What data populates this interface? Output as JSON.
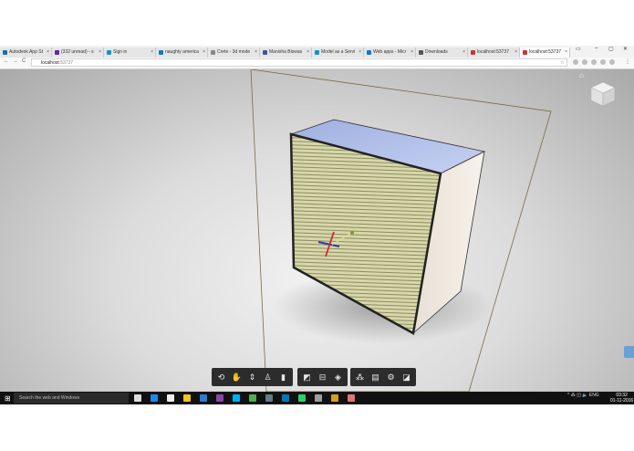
{
  "browser": {
    "tabs": [
      {
        "label": "Autodesk App St",
        "color": "#0b72b5"
      },
      {
        "label": "(332 unread) - s",
        "color": "#6b21a8"
      },
      {
        "label": "Sign in",
        "color": "#0696d7"
      },
      {
        "label": "naughty america",
        "color": "#0a7cc1"
      },
      {
        "label": "Crete - 3d mode",
        "color": "#888888"
      },
      {
        "label": "Manisha Biswas",
        "color": "#3b5998"
      },
      {
        "label": "Model as a Servi",
        "color": "#0696d7"
      },
      {
        "label": "Web apps - Micr",
        "color": "#0078d7"
      },
      {
        "label": "Downloads",
        "color": "#555555"
      },
      {
        "label": "localhost:53737",
        "color": "#cc3333"
      },
      {
        "label": "localhost:53737",
        "color": "#cc3333"
      }
    ],
    "window_controls": {
      "minimize": "–",
      "maximize": "▢",
      "close": "✕"
    },
    "address": {
      "host": "localhost",
      "path": ":53737"
    },
    "nav": {
      "back": "←",
      "forward": "→",
      "reload": "C"
    },
    "star": "☆",
    "menu": "⋮"
  },
  "viewer": {
    "home_icon": "⌂",
    "toolbar_groups": [
      [
        "orbit-icon",
        "pan-icon",
        "dolly-icon",
        "first-person-icon",
        "camera-icon"
      ],
      [
        "measure-icon",
        "section-icon",
        "explode-icon"
      ],
      [
        "model-browser-icon",
        "properties-icon",
        "settings-icon",
        "fullscreen-icon"
      ]
    ],
    "toolbar_glyphs": {
      "orbit-icon": "⟲",
      "pan-icon": "✋",
      "dolly-icon": "⇕",
      "first-person-icon": "♙",
      "camera-icon": "▮",
      "measure-icon": "◩",
      "section-icon": "⊟",
      "explode-icon": "◈",
      "model-browser-icon": "⁂",
      "properties-icon": "▤",
      "settings-icon": "⚙",
      "fullscreen-icon": "◪"
    },
    "colors": {
      "front_face": "#d7d7a8",
      "top_face": "#a9b8e6",
      "side_face": "#efe7dd",
      "toolbar": "#2c2c2c"
    }
  },
  "taskbar": {
    "start_icon": "⊞",
    "search_placeholder": "Search the web and Windows",
    "apps": [
      {
        "name": "task-view-icon",
        "color": "#dddddd"
      },
      {
        "name": "edge-icon",
        "color": "#1e88e5"
      },
      {
        "name": "store-icon",
        "color": "#eeeeee"
      },
      {
        "name": "file-explorer-icon",
        "color": "#f5c518"
      },
      {
        "name": "mail-icon",
        "color": "#2b7cd3"
      },
      {
        "name": "visual-studio-icon",
        "color": "#8e44ad"
      },
      {
        "name": "skype-icon",
        "color": "#00aff0"
      },
      {
        "name": "chrome-icon",
        "color": "#4caf50"
      },
      {
        "name": "app-icon-9",
        "color": "#607d8b"
      },
      {
        "name": "app-icon-10",
        "color": "#0277bd"
      },
      {
        "name": "whatsapp-icon",
        "color": "#25d366"
      },
      {
        "name": "app-icon-12",
        "color": "#9e9e9e"
      },
      {
        "name": "app-icon-13",
        "color": "#d4a017"
      },
      {
        "name": "app-icon-14",
        "color": "#e57373"
      }
    ],
    "tray": "^ ⁂ ◫ 🔈 ENG",
    "time": "03:32",
    "date": "01-11-2016"
  }
}
